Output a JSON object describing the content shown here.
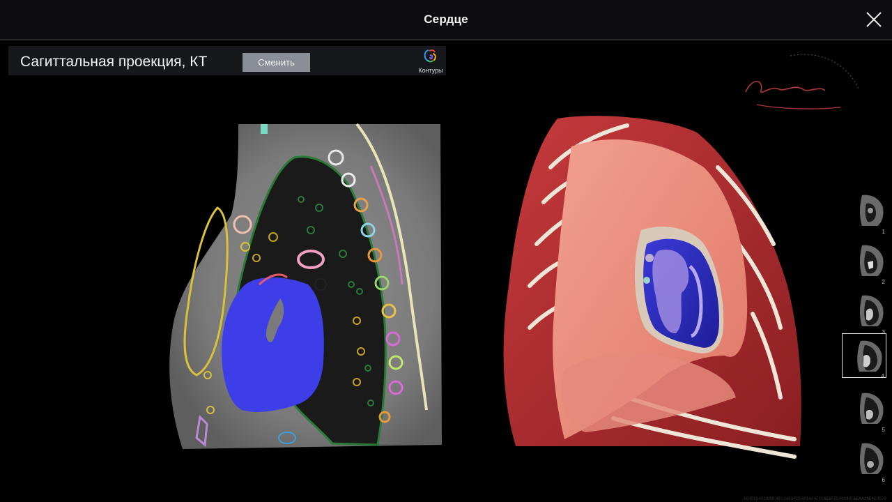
{
  "window": {
    "title": "Сердце"
  },
  "left_panel": {
    "projection_title": "Сагиттальная проекция, КТ",
    "change_button_label": "Сменить",
    "contours_label": "Контуры"
  },
  "logo": {
    "signature": "Пирогов",
    "arc_text": "ИНТЕРАКТИВНАЯ АНАТОМИЯ"
  },
  "thumbnails": [
    {
      "number": "1",
      "active": false
    },
    {
      "number": "2",
      "active": false
    },
    {
      "number": "3",
      "active": false
    },
    {
      "number": "4",
      "active": true
    },
    {
      "number": "5",
      "active": false
    },
    {
      "number": "6",
      "active": false
    }
  ],
  "footer_hash": "AE8FED401A88CAEC2AE8FED401A84FCCAE8FED401A8CAEAA2AEAE0520"
}
